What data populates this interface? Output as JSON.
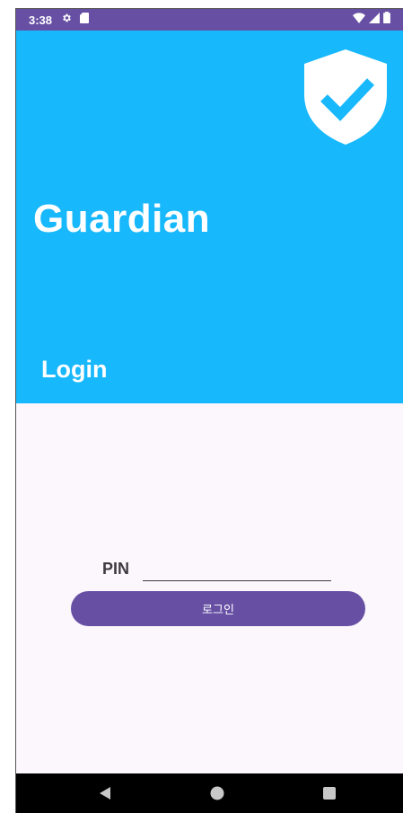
{
  "status_bar": {
    "time": "3:38",
    "left_icons": [
      "gear-icon",
      "sd-card-icon"
    ],
    "right_icons": [
      "wifi-icon",
      "signal-icon",
      "battery-icon"
    ],
    "color": "#6750a4"
  },
  "header": {
    "title": "Guardian",
    "subtitle": "Login",
    "logo_icon": "shield-check-icon",
    "color": "#17b8fc"
  },
  "form": {
    "pin_label": "PIN",
    "pin_value": "",
    "login_button_label": "로그인",
    "button_color": "#6750a4"
  },
  "nav_bar": {
    "buttons": [
      "back-icon",
      "home-icon",
      "recents-icon"
    ]
  }
}
